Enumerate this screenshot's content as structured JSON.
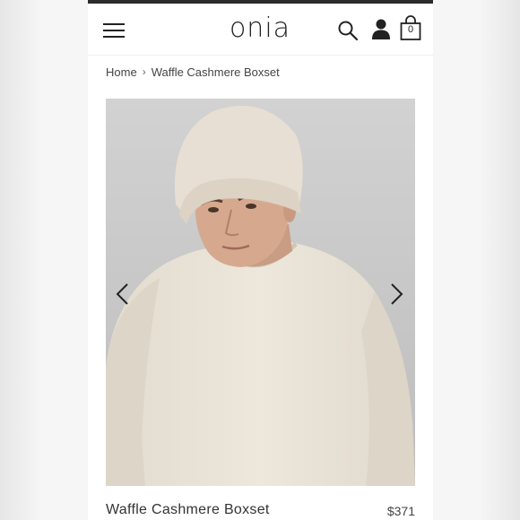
{
  "brand": {
    "logo_text": "onia"
  },
  "header": {
    "menu_icon": "hamburger-menu-icon",
    "search_icon": "search-icon",
    "account_icon": "user-icon",
    "cart_icon": "shopping-bag-icon",
    "cart_count": "0"
  },
  "breadcrumb": {
    "home": "Home",
    "separator": "›",
    "current": "Waffle Cashmere Boxset"
  },
  "gallery": {
    "prev_icon": "chevron-left-icon",
    "next_icon": "chevron-right-icon"
  },
  "product": {
    "name": "Waffle Cashmere Boxset",
    "price": "$371"
  },
  "colors": {
    "text": "#222222",
    "photo_background": "#c9c9c9",
    "sweater": "#e9e2d6"
  }
}
